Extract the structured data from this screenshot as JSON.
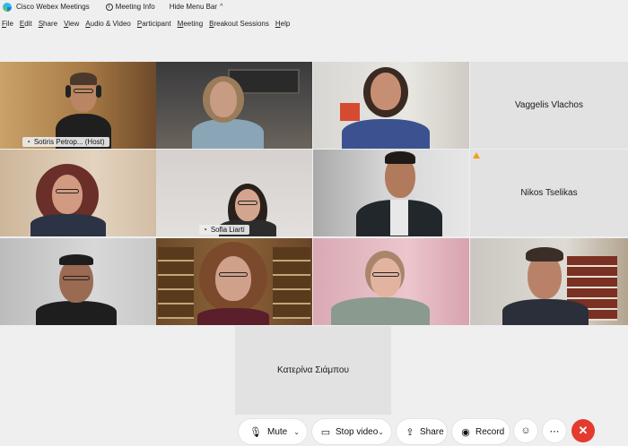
{
  "window": {
    "app_title": "Cisco Webex Meetings",
    "meeting_info": "Meeting Info",
    "hide_menu_bar": "Hide Menu Bar"
  },
  "menu": [
    "File",
    "Edit",
    "Share",
    "View",
    "Audio & Video",
    "Participant",
    "Meeting",
    "Breakout Sessions",
    "Help"
  ],
  "participants": {
    "sotiris": "Sotiris Petrop... (Host)",
    "sofia": "Sofia Liarti",
    "vaggelis": "Vaggelis Vlachos",
    "nikos": "Nikos Tselikas",
    "katerina": "Κατερίνα Σιάμπου"
  },
  "controls": {
    "mute": "Mute",
    "stop_video": "Stop video",
    "share": "Share",
    "record": "Record"
  },
  "colors": {
    "active_speaker_border": "#25a8e0",
    "end_call": "#e33b2e",
    "warning": "#f0a020"
  }
}
